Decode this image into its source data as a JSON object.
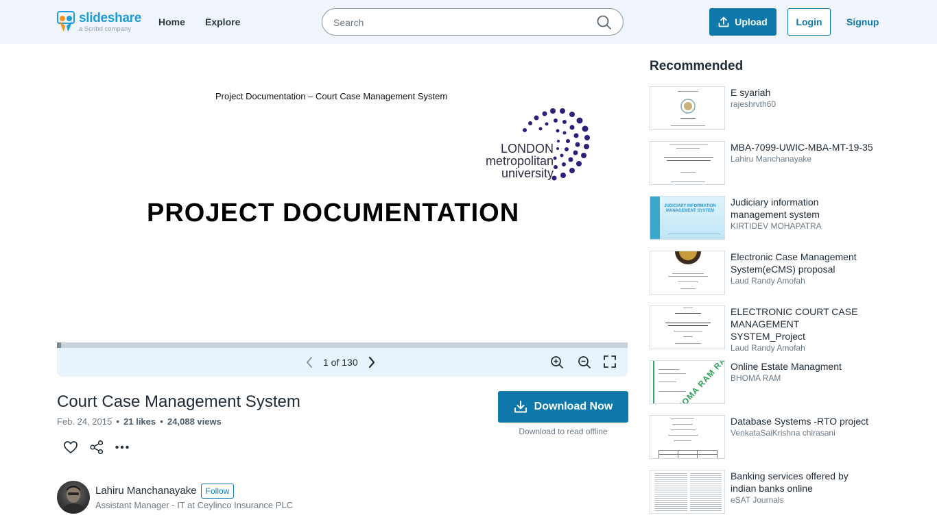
{
  "header": {
    "logo_word": "slideshare",
    "logo_sub": "a Scribd company",
    "nav": [
      "Home",
      "Explore"
    ],
    "search_placeholder": "Search",
    "upload_label": "Upload",
    "login_label": "Login",
    "signup_label": "Signup"
  },
  "slide": {
    "top_line": "Project Documentation – Court Case Management System",
    "logo_line1": "LONDON",
    "logo_line2": "metropolitan",
    "logo_line3": "university",
    "headline": "PROJECT DOCUMENTATION",
    "progress_fraction": 0.0077
  },
  "viewer": {
    "page_indicator": "1 of 130",
    "icons": [
      "chevron-left-icon",
      "chevron-right-icon",
      "zoom-in-icon",
      "zoom-out-icon",
      "fullscreen-icon"
    ]
  },
  "document": {
    "title": "Court Case Management System",
    "date": "Feb. 24, 2015",
    "likes": "21 likes",
    "views": "24,088 views",
    "download_label": "Download Now",
    "download_sub": "Download to read offline",
    "actions": [
      "heart-icon",
      "share-icon",
      "more-icon"
    ]
  },
  "author": {
    "name": "Lahiru Manchanayake",
    "follow_label": "Follow",
    "role": "Assistant Manager - IT at Ceylinco Insurance PLC"
  },
  "recommended": {
    "heading": "Recommended",
    "items": [
      {
        "title": "E syariah",
        "author": "rajeshrvth60"
      },
      {
        "title": "MBA-7099-UWIC-MBA-MT-19-35",
        "author": "Lahiru Manchanayake"
      },
      {
        "title": "Judiciary information management system",
        "author": "KIRTIDEV MOHAPATRA",
        "thumb_text": "JUDICIARY INFORMATION MANAGEMENT SYSTEM"
      },
      {
        "title": "Electronic Case Management System(eCMS) proposal",
        "author": "Laud Randy Amofah"
      },
      {
        "title": "ELECTRONIC COURT CASE MANAGEMENT SYSTEM_Project",
        "author": "Laud Randy Amofah"
      },
      {
        "title": "Online Estate Managment",
        "author": "BHOMA RAM",
        "thumb_text": "BHOMA RAM RAR"
      },
      {
        "title": "Database Systems -RTO project",
        "author": "VenkataSaiKrishna chirasani"
      },
      {
        "title": "Banking services offered by indian banks online",
        "author": "eSAT Journals"
      }
    ]
  },
  "colors": {
    "accent": "#0e78ab",
    "header_bg": "#f0f4fb",
    "viewer_bar_bg": "#e9f3fb",
    "logo_blue": "#1e9cd7",
    "lmu_purple": "#2d1f7a"
  }
}
